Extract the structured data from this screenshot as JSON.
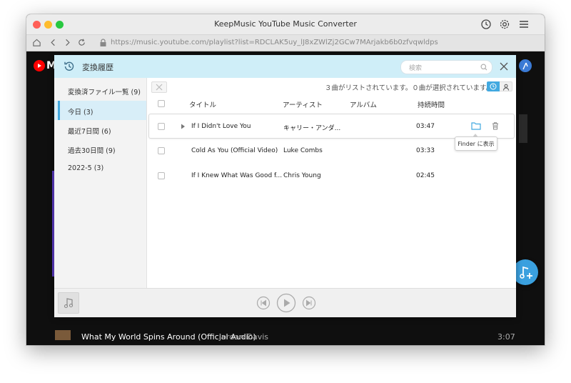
{
  "window": {
    "title": "KeepMusic YouTube Music Converter"
  },
  "browser": {
    "url": "https://music.youtube.com/playlist?list=RDCLAK5uy_lJ8xZWlZj2GCw7MArjakb6b0zfvqwldps"
  },
  "background": {
    "logo_letter": "M",
    "row": {
      "title": "What My World Spins Around (Official Audio)",
      "artist": "Jordan Davis",
      "duration": "3:07"
    }
  },
  "dialog": {
    "title": "変換履歴",
    "search_placeholder": "検索",
    "sidebar": [
      {
        "label": "変換済ファイル一覧",
        "count": "(9)"
      },
      {
        "label": "今日",
        "count": "(3)"
      },
      {
        "label": "最近7日間",
        "count": "(6)"
      },
      {
        "label": "過去30日間",
        "count": "(9)"
      },
      {
        "label": "2022-5",
        "count": "(3)"
      }
    ],
    "status_text": "３曲がリストされています。０曲が選択されています。",
    "columns": {
      "title": "タイトル",
      "artist": "アーティスト",
      "album": "アルバム",
      "duration": "持続時間"
    },
    "rows": [
      {
        "title": "If I Didn't Love You",
        "artist": "キャリー・アンダ...",
        "album": "",
        "duration": "03:47"
      },
      {
        "title": "Cold As You (Official Video)",
        "artist": "Luke Combs",
        "album": "",
        "duration": "03:33"
      },
      {
        "title": "If I Knew What Was Good f...",
        "artist": "Chris Young",
        "album": "",
        "duration": "02:45"
      }
    ],
    "tooltip": "Finder に表示"
  },
  "colors": {
    "accent": "#42a9e0",
    "header_bg": "#cfeef8",
    "traffic_red": "#ff5f57",
    "traffic_yellow": "#febc2e",
    "traffic_green": "#28c840"
  }
}
